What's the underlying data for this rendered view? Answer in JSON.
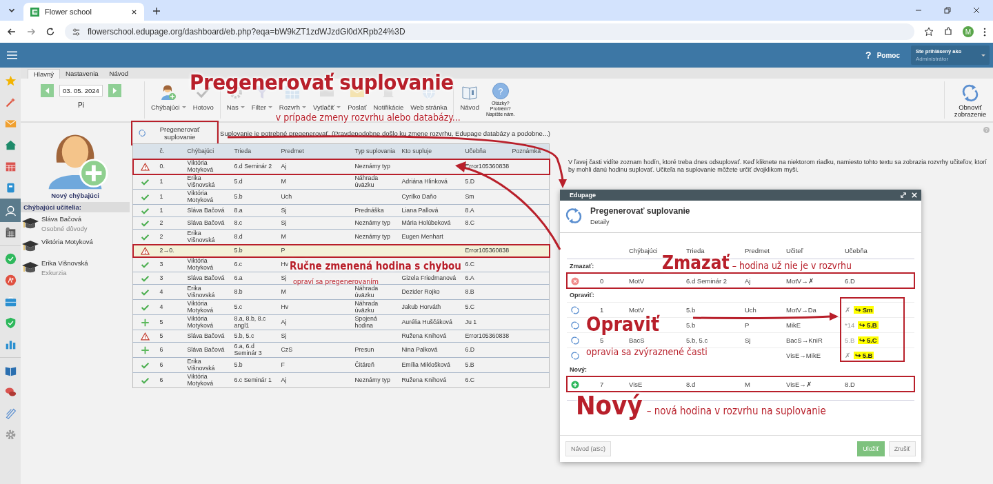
{
  "browser": {
    "tab_title": "Flower school",
    "url": "flowerschool.edupage.org/dashboard/eb.php?eqa=bW9kZT1zdWJzdGl0dXRpb24%3D",
    "profile_initial": "M"
  },
  "header": {
    "help_mark": "?",
    "help": "Pomoc",
    "login_label": "Ste prihlásený ako",
    "login_user": "Administrátor"
  },
  "rail": [
    {
      "kind": "star",
      "selected": false
    },
    {
      "kind": "wand",
      "selected": false
    },
    {
      "kind": "mail",
      "selected": false
    },
    {
      "kind": "home",
      "selected": false
    },
    {
      "kind": "calendar",
      "selected": false
    },
    {
      "kind": "notebook",
      "selected": false
    },
    {
      "kind": "person",
      "selected": true
    },
    {
      "kind": "planner",
      "selected": false
    },
    {
      "kind": "check",
      "selected": false
    },
    {
      "kind": "grade",
      "selected": false
    },
    {
      "kind": "briefcase",
      "selected": false
    },
    {
      "kind": "shield",
      "selected": false
    },
    {
      "kind": "chart",
      "selected": false
    },
    {
      "kind": "book",
      "selected": false
    },
    {
      "kind": "chat",
      "selected": false
    },
    {
      "kind": "pen",
      "selected": false
    },
    {
      "kind": "gear",
      "selected": false
    }
  ],
  "tabs": [
    {
      "label": "Hlavný",
      "selected": true
    },
    {
      "label": "Nastavenia",
      "selected": false
    },
    {
      "label": "Návod",
      "selected": false
    }
  ],
  "date_nav": {
    "date": "03. 05. 2024",
    "day": "Pi"
  },
  "toolbar": [
    {
      "label": "Chýbajúci",
      "kind": "person",
      "dropdown": true
    },
    {
      "label": "Hotovo",
      "kind": "check",
      "dropdown": false
    },
    {
      "label": "Nas",
      "kind": "gear",
      "dropdown": true
    },
    {
      "label": "Filter",
      "kind": "funnel",
      "dropdown": true
    },
    {
      "label": "Rozvrh",
      "kind": "grid",
      "dropdown": true
    },
    {
      "label": "Vytlačiť",
      "kind": "printer",
      "dropdown": true
    },
    {
      "label": "Poslať",
      "kind": "mail",
      "dropdown": false
    },
    {
      "label": "Notifikácie",
      "kind": "bell",
      "dropdown": false
    },
    {
      "label": "Web stránka",
      "kind": "globe",
      "dropdown": false
    },
    {
      "label": "Návod",
      "kind": "book",
      "dropdown": false
    }
  ],
  "help_button": {
    "mark": "?",
    "lines": [
      "Otázky?",
      "Problém?",
      "Napíšte nám."
    ]
  },
  "refresh_button": {
    "lines": [
      "Obnoviť",
      "zobrazenie"
    ]
  },
  "corner_help": "?",
  "new_absent": "Nový chýbajúci",
  "absent_heading": "Chýbajúci učitelia:",
  "absent_teachers": [
    {
      "name": "Sláva Bačová",
      "reason": "Osobné dôvody"
    },
    {
      "name": "Viktória Motyková"
    },
    {
      "name": "Erika Višnovská",
      "reason": "Exkurzia"
    }
  ],
  "regenerate": {
    "button": "Pregenerovať suplovanie",
    "marked": true,
    "message": "Suplovanie je potrebné pregenerovať. (Pravdepodobne došlo ku zmene rozvrhu, Edupage databázy a podobne...)"
  },
  "table": {
    "columns": [
      "č.",
      "Chýbajúci",
      "Trieda",
      "Predmet",
      "Typ suplovania",
      "Kto supluje",
      "Učebňa",
      "Poznámka"
    ],
    "rows": [
      {
        "kind": "warning",
        "selected": false,
        "marked": true,
        "num": "0.",
        "absent": "Viktória Motyková",
        "class": "6.d Seminár 2",
        "subject": "Aj",
        "type": "Neznámy typ",
        "room": "Error105360838"
      },
      {
        "kind": "ok",
        "selected": false,
        "marked": false,
        "num": "1",
        "absent": "Erika Višnovská",
        "class": "5.d",
        "subject": "M",
        "type": "Náhrada úväzku",
        "substitute": "Adriána Hlinková",
        "room": "5.D"
      },
      {
        "kind": "ok",
        "selected": false,
        "marked": false,
        "num": "1",
        "absent": "Viktória Motyková",
        "class": "5.b",
        "subject": "Uch",
        "substitute": "Cyrilko Daňo",
        "room": "Sm"
      },
      {
        "kind": "ok",
        "selected": false,
        "marked": false,
        "num": "1",
        "absent": "Sláva Bačová",
        "class": "8.a",
        "subject": "Sj",
        "type": "Prednáška",
        "substitute": "Liana Pallová",
        "room": "8.A"
      },
      {
        "kind": "ok",
        "selected": false,
        "marked": false,
        "num": "2",
        "absent": "Sláva Bačová",
        "class": "8.c",
        "subject": "Sj",
        "type": "Neznámy typ",
        "substitute": "Mária Holúbeková",
        "room": "8.C"
      },
      {
        "kind": "ok",
        "selected": false,
        "marked": false,
        "num": "2",
        "absent": "Erika Višnovská",
        "class": "8.d",
        "subject": "M",
        "type": "Neznámy typ",
        "substitute": "Eugen Menhart"
      },
      {
        "kind": "warning",
        "selected": true,
        "marked": true,
        "num": "2→0.",
        "class": "5.b",
        "subject": "P",
        "room": "Error105360838"
      },
      {
        "kind": "ok",
        "selected": false,
        "marked": false,
        "num": "3",
        "absent": "Viktória Motyková",
        "class": "6.c",
        "subject": "Hv",
        "room": "6.C"
      },
      {
        "kind": "ok",
        "selected": false,
        "marked": false,
        "num": "3",
        "absent": "Sláva Bačová",
        "class": "6.a",
        "subject": "Sj",
        "substitute": "Gizela Friedmanová",
        "room": "6.A"
      },
      {
        "kind": "ok",
        "selected": false,
        "marked": false,
        "num": "4",
        "absent": "Erika Višnovská",
        "class": "8.b",
        "subject": "M",
        "type": "Náhrada úväzku",
        "substitute": "Dezider Rojko",
        "room": "8.B"
      },
      {
        "kind": "ok",
        "selected": false,
        "marked": false,
        "num": "4",
        "absent": "Viktória Motyková",
        "class": "5.c",
        "subject": "Hv",
        "type": "Náhrada úväzku",
        "substitute": "Jakub Horváth",
        "room": "5.C"
      },
      {
        "kind": "plus",
        "selected": false,
        "marked": false,
        "num": "5",
        "absent": "Viktória Motyková",
        "class": "8.a, 8.b, 8.c angl1",
        "subject": "Aj",
        "type": "Spojená hodina",
        "substitute": "Aurélia Huščáková",
        "room": "Ju 1"
      },
      {
        "kind": "warning",
        "selected": false,
        "marked": false,
        "num": "5",
        "absent": "Sláva Bačová",
        "class": "5.b, 5.c",
        "subject": "Sj",
        "substitute": "Ružena Knihová",
        "room": "Error105360838"
      },
      {
        "kind": "plus",
        "selected": false,
        "marked": false,
        "num": "6",
        "absent": "Sláva Bačová",
        "class": "6.a, 6.d Seminár 3",
        "subject": "CzS",
        "type": "Presun",
        "substitute": "Nina Palková",
        "room": "6.D"
      },
      {
        "kind": "ok",
        "selected": false,
        "marked": false,
        "num": "6",
        "absent": "Erika Višnovská",
        "class": "5.b",
        "subject": "F",
        "type": "Čitáreň",
        "substitute": "Emília Miklošková",
        "room": "5.B"
      },
      {
        "kind": "ok",
        "selected": false,
        "marked": false,
        "num": "6",
        "absent": "Viktória Motyková",
        "class": "6.c Seminár 1",
        "subject": "Aj",
        "type": "Neznámy typ",
        "substitute": "Ružena Knihová",
        "room": "6.C"
      }
    ]
  },
  "info_text": "V ľavej časti vidíte zoznam hodín, ktoré treba dnes odsuplovať. Keď kliknete na niektorom riadku, namiesto tohto textu sa zobrazia rozvrhy učiteľov, ktorí by mohli danú hodinu suplovať. Učiteľa na suplovanie môžete určiť dvojklikom myši.",
  "dialog": {
    "window_title": "Edupage",
    "title": "Pregenerovať suplovanie",
    "subtitle": "Detaily",
    "columns": [
      "Chýbajúci",
      "Trieda",
      "Predmet",
      "Učiteľ",
      "Učebňa"
    ],
    "sections": [
      {
        "label": "Zmazať:",
        "kind": "delete",
        "marked": true,
        "rows": [
          {
            "num": "0",
            "absent": "MotV",
            "class": "6.d Seminár 2",
            "subject": "Aj",
            "teacher": "MotV→✗",
            "room": "6.D"
          }
        ]
      },
      {
        "label": "Opraviť:",
        "kind": "fix",
        "marked": false,
        "rows": [
          {
            "num": "1",
            "absent": "MotV",
            "class": "5.b",
            "subject": "Uch",
            "teacher": "MotV→Da",
            "room": "✗",
            "room_new": "↪ Sm"
          },
          {
            "class": "5.b",
            "subject": "P",
            "teacher": "MikE",
            "room": "*14",
            "room_new": "↪ 5.B"
          },
          {
            "num": "5",
            "absent": "BacS",
            "class": "5.b, 5.c",
            "subject": "Sj",
            "teacher": "BacS→KniR",
            "room": "5.B",
            "room_new": "↪ 5.C"
          },
          {
            "teacher": "VisE→MikE",
            "room": "✗",
            "room_new": "↪ 5.B"
          }
        ]
      },
      {
        "label": "Nový:",
        "kind": "new",
        "marked": true,
        "rows": [
          {
            "num": "7",
            "absent": "VisE",
            "class": "8.d",
            "subject": "M",
            "teacher": "VisE→✗",
            "room": "8.D"
          }
        ]
      }
    ],
    "buttons": {
      "help": "Návod (aSc)",
      "save": "Uložiť",
      "cancel": "Zrušiť"
    }
  },
  "annotations": [
    {
      "title": "Pregenerovať suplovanie",
      "note": "v prípade zmeny rozvrhu alebo databázy..."
    },
    {
      "title": "Ručne zmenená hodina s chybou",
      "note": "opraví sa pregenerovaním"
    },
    {
      "title": "Zmazať",
      "note": "– hodina už nie je v rozvrhu"
    },
    {
      "title": "Opraviť",
      "note": "opravia sa zvýraznené časti"
    },
    {
      "title": "Nový",
      "note": "– nová hodina v rozvrhu na suplovanie"
    }
  ]
}
